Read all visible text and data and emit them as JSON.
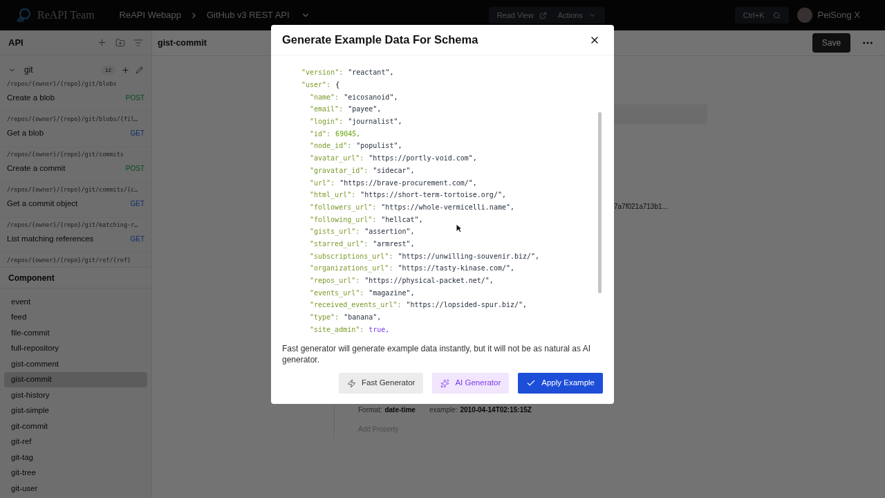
{
  "topbar": {
    "team": "ReAPI Team",
    "breadcrumb": [
      "ReAPI Webapp",
      "GitHub v3 REST API"
    ],
    "read_view": "Read View",
    "actions": "Actions",
    "search_shortcut": "Ctrl+K",
    "user": "PeiSong X"
  },
  "sidebar": {
    "title": "API",
    "folder": {
      "name": "git",
      "count": "12",
      "expanded": true
    },
    "endpoints": [
      {
        "path": "/repos/{owner}/{repo}/git/blobs",
        "name": "Create a blob",
        "method": "POST"
      },
      {
        "path": "/repos/{owner}/{repo}/git/blobs/{fil…",
        "name": "Get a blob",
        "method": "GET"
      },
      {
        "path": "/repos/{owner}/{repo}/git/commits",
        "name": "Create a commit",
        "method": "POST"
      },
      {
        "path": "/repos/{owner}/{repo}/git/commits/{c…",
        "name": "Get a commit object",
        "method": "GET"
      },
      {
        "path": "/repos/{owner}/{repo}/git/matching-r…",
        "name": "List matching references",
        "method": "GET"
      }
    ],
    "trailing_path": "/repos/{owner}/{repo}/git/ref/{ref}",
    "component_title": "Component",
    "components": [
      {
        "label": "event",
        "selected": false
      },
      {
        "label": "feed",
        "selected": false
      },
      {
        "label": "file-commit",
        "selected": false
      },
      {
        "label": "full-repository",
        "selected": false
      },
      {
        "label": "gist-comment",
        "selected": false
      },
      {
        "label": "gist-commit",
        "selected": true
      },
      {
        "label": "gist-history",
        "selected": false
      },
      {
        "label": "gist-simple",
        "selected": false
      },
      {
        "label": "git-commit",
        "selected": false
      },
      {
        "label": "git-ref",
        "selected": false
      },
      {
        "label": "git-tag",
        "selected": false
      },
      {
        "label": "git-tree",
        "selected": false
      },
      {
        "label": "git-user",
        "selected": false
      }
    ]
  },
  "main": {
    "title": "gist-commit",
    "save": "Save",
    "hash": "7a7f021a713b1...",
    "format_label": "Format:",
    "format": "date-time",
    "example_label": "example:",
    "example": "2010-04-14T02:15:15Z",
    "add_property": "Add Property"
  },
  "modal": {
    "title": "Generate Example Data For Schema",
    "code": [
      {
        "key": "\"version\":",
        "value": "\"reactant\",",
        "kind": "string"
      },
      {
        "key": "\"user\":",
        "value": "{",
        "kind": "object",
        "children": [
          {
            "key": "\"name\":",
            "value": "\"eicosanoid\",",
            "kind": "string"
          },
          {
            "key": "\"email\":",
            "value": "\"payee\",",
            "kind": "string"
          },
          {
            "key": "\"login\":",
            "value": "\"journalist\",",
            "kind": "string"
          },
          {
            "key": "\"id\":",
            "value": "69045,",
            "kind": "number"
          },
          {
            "key": "\"node_id\":",
            "value": "\"populist\",",
            "kind": "string"
          },
          {
            "key": "\"avatar_url\":",
            "value": "\"https://portly-void.com\",",
            "kind": "string"
          },
          {
            "key": "\"gravatar_id\":",
            "value": "\"sidecar\",",
            "kind": "string"
          },
          {
            "key": "\"url\":",
            "value": "\"https://brave-procurement.com/\",",
            "kind": "string"
          },
          {
            "key": "\"html_url\":",
            "value": "\"https://short-term-tortoise.org/\",",
            "kind": "string"
          },
          {
            "key": "\"followers_url\":",
            "value": "\"https://whole-vermicelli.name\",",
            "kind": "string"
          },
          {
            "key": "\"following_url\":",
            "value": "\"hellcat\",",
            "kind": "string"
          },
          {
            "key": "\"gists_url\":",
            "value": "\"assertion\",",
            "kind": "string"
          },
          {
            "key": "\"starred_url\":",
            "value": "\"armrest\",",
            "kind": "string"
          },
          {
            "key": "\"subscriptions_url\":",
            "value": "\"https://unwilling-souvenir.biz/\",",
            "kind": "string"
          },
          {
            "key": "\"organizations_url\":",
            "value": "\"https://tasty-kinase.com/\",",
            "kind": "string"
          },
          {
            "key": "\"repos_url\":",
            "value": "\"https://physical-packet.net/\",",
            "kind": "string"
          },
          {
            "key": "\"events_url\":",
            "value": "\"magazine\",",
            "kind": "string"
          },
          {
            "key": "\"received_events_url\":",
            "value": "\"https://lopsided-spur.biz/\",",
            "kind": "string"
          },
          {
            "key": "\"type\":",
            "value": "\"banana\",",
            "kind": "string"
          },
          {
            "key": "\"site_admin\":",
            "value": "true,",
            "kind": "boolean"
          }
        ]
      }
    ],
    "note": "Fast generator will generate example data instantly, but it will not be as natural as AI generator.",
    "buttons": [
      {
        "label": "Fast Generator",
        "kind": "fast"
      },
      {
        "label": "AI Generator",
        "kind": "ai"
      },
      {
        "label": "Apply Example",
        "kind": "apply"
      }
    ]
  }
}
